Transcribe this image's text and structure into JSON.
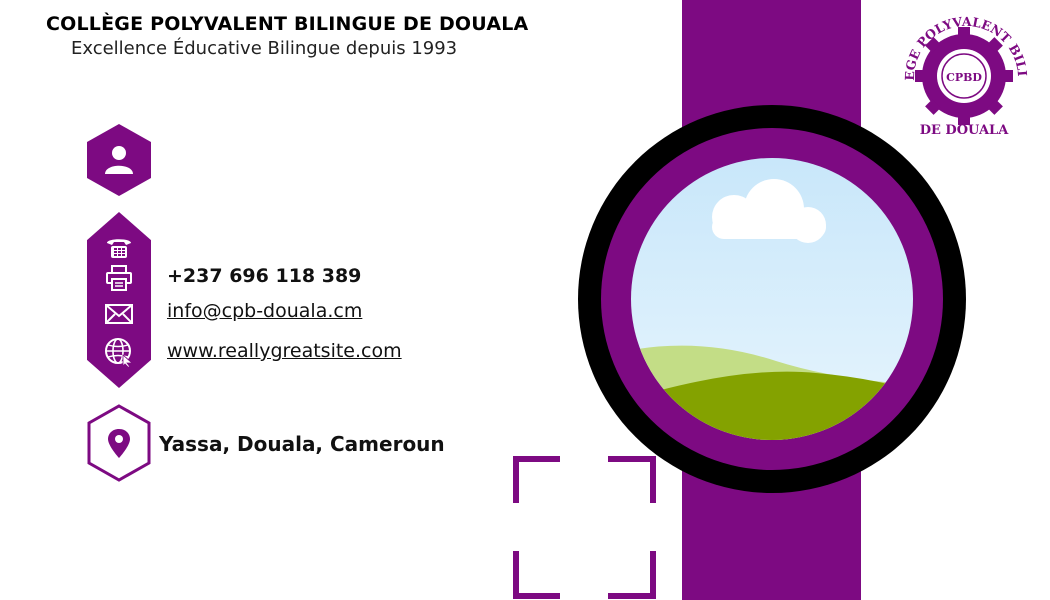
{
  "header": {
    "school_name": "COLLÈGE POLYVALENT BILINGUE DE DOUALA",
    "tagline": "Excellence Éducative Bilingue depuis 1993"
  },
  "contact": {
    "phone": "+237 696 118 389",
    "email": "info@cpb-douala.cm",
    "website": "www.reallygreatsite.com",
    "address": "Yassa, Douala, Cameroun"
  },
  "logo": {
    "ring_text": "COLLEGE POLYVALENT BILINGUE",
    "bottom_text": "DE DOUALA",
    "monogram": "CPBD"
  },
  "colors": {
    "accent": "#7d0a82",
    "ring": "#000000",
    "sky": "#d4ecfb",
    "hill_light": "#c3dd86",
    "hill_dark": "#84a200",
    "background": "#ffffff"
  },
  "icons": [
    "person-icon",
    "telephone-icon",
    "fax-icon",
    "mail-icon",
    "globe-icon",
    "location-pin-icon",
    "image-placeholder-icon"
  ]
}
